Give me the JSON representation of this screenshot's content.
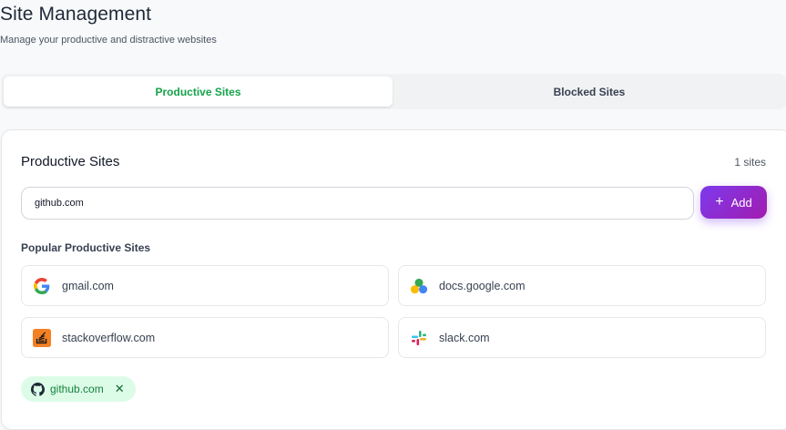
{
  "header": {
    "title": "Site Management",
    "subtitle": "Manage your productive and distractive websites"
  },
  "tabs": [
    {
      "label": "Productive Sites",
      "active": true
    },
    {
      "label": "Blocked Sites",
      "active": false
    }
  ],
  "card": {
    "title": "Productive Sites",
    "count": "1 sites",
    "input_value": "github.com",
    "add_label": "Add",
    "popular_label": "Popular Productive Sites",
    "popular_sites": [
      {
        "name": "gmail.com",
        "icon": "google-icon"
      },
      {
        "name": "docs.google.com",
        "icon": "google-drive-icon"
      },
      {
        "name": "stackoverflow.com",
        "icon": "stackoverflow-icon"
      },
      {
        "name": "slack.com",
        "icon": "slack-icon"
      }
    ],
    "added_sites": [
      {
        "name": "github.com",
        "icon": "github-icon"
      }
    ]
  },
  "colors": {
    "accent_green": "#16a34a",
    "add_gradient_start": "#7c3aed",
    "add_gradient_end": "#a21caf",
    "chip_bg": "#dcfce7"
  }
}
